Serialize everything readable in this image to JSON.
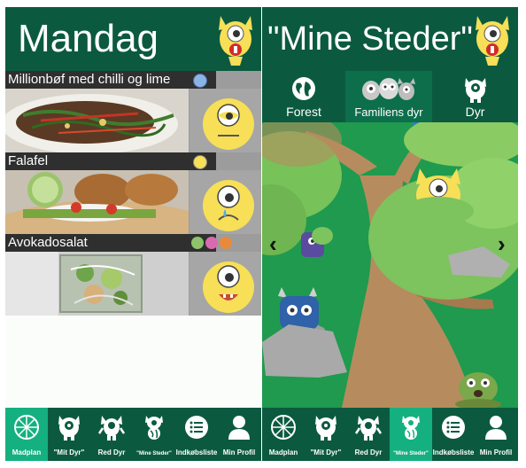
{
  "left_screen": {
    "title": "Mandag",
    "foods": [
      {
        "name": "Millionbøf med chilli og lime"
      },
      {
        "name": "Falafel"
      },
      {
        "name": "Avokadosalat"
      }
    ]
  },
  "right_screen": {
    "title": "\"Mine Steder\"",
    "tabs": [
      {
        "label": "Forest",
        "icon": "globe-icon"
      },
      {
        "label": "Familiens dyr",
        "icon": "monster-family-icon"
      },
      {
        "label": "Dyr",
        "icon": "monster-icon"
      }
    ],
    "nav_prev": "‹",
    "nav_next": "›"
  },
  "bottom_nav": [
    {
      "label": "Madplan",
      "icon": "lemon-slice-icon"
    },
    {
      "label": "\"Mit Dyr\"",
      "icon": "monster-icon"
    },
    {
      "label": "Red Dyr",
      "icon": "monster-arms-icon"
    },
    {
      "label": "\"Mine Steder\"",
      "icon": "monster-globe-icon"
    },
    {
      "label": "Indkøbsliste",
      "icon": "list-icon"
    },
    {
      "label": "Min Profil",
      "icon": "profile-icon"
    }
  ],
  "colors": {
    "header_green": "#0b5a40",
    "active_tab": "#15b07f",
    "forest_green": "#1f9a4e",
    "monster_yellow": "#f7df57"
  }
}
